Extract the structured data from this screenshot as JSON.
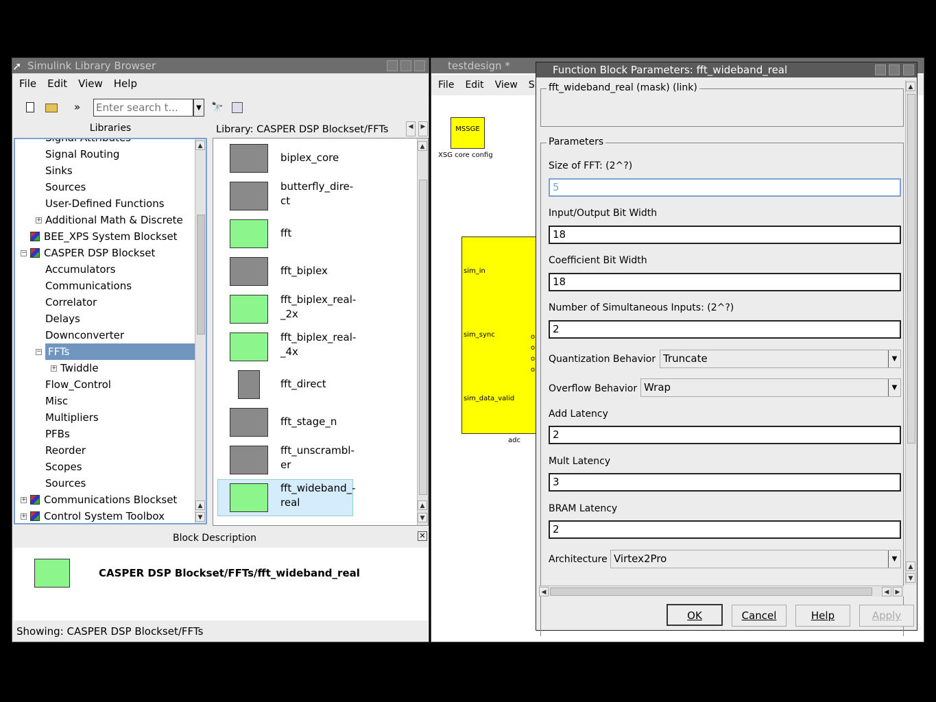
{
  "libbrowser": {
    "title": "Simulink Library Browser",
    "menu": [
      "File",
      "Edit",
      "View",
      "Help"
    ],
    "search_placeholder": "Enter search t...",
    "overflow": "»",
    "libraries_header": "Libraries",
    "library_path": "Library: CASPER DSP Blockset/FFTs",
    "tree": [
      {
        "label": "Signal Attributes",
        "indent": 1
      },
      {
        "label": "Signal Routing",
        "indent": 1
      },
      {
        "label": "Sinks",
        "indent": 1
      },
      {
        "label": "Sources",
        "indent": 1
      },
      {
        "label": "User-Defined Functions",
        "indent": 1
      },
      {
        "label": "Additional Math & Discrete",
        "indent": 1
      },
      {
        "label": "BEE_XPS System Blockset",
        "indent": 0
      },
      {
        "label": "CASPER DSP Blockset",
        "indent": 0
      },
      {
        "label": "Accumulators",
        "indent": 1
      },
      {
        "label": "Communications",
        "indent": 1
      },
      {
        "label": "Correlator",
        "indent": 1
      },
      {
        "label": "Delays",
        "indent": 1
      },
      {
        "label": "Downconverter",
        "indent": 1
      },
      {
        "label": "FFTs",
        "indent": 1
      },
      {
        "label": "Twiddle",
        "indent": 2
      },
      {
        "label": "Flow_Control",
        "indent": 1
      },
      {
        "label": "Misc",
        "indent": 1
      },
      {
        "label": "Multipliers",
        "indent": 1
      },
      {
        "label": "PFBs",
        "indent": 1
      },
      {
        "label": "Reorder",
        "indent": 1
      },
      {
        "label": "Scopes",
        "indent": 1
      },
      {
        "label": "Sources",
        "indent": 1
      },
      {
        "label": "Communications Blockset",
        "indent": 0
      },
      {
        "label": "Control System Toolbox",
        "indent": 0
      }
    ],
    "blocks": [
      {
        "label": "biplex_core",
        "color": "grey"
      },
      {
        "label": "butterfly_dire-\nct",
        "color": "grey"
      },
      {
        "label": "fft",
        "color": "green"
      },
      {
        "label": "fft_biplex",
        "color": "grey"
      },
      {
        "label": "fft_biplex_real-\n_2x",
        "color": "green"
      },
      {
        "label": "fft_biplex_real-\n_4x",
        "color": "green"
      },
      {
        "label": "fft_direct",
        "color": "grey"
      },
      {
        "label": "fft_stage_n",
        "color": "grey"
      },
      {
        "label": "fft_unscrambl-\ner",
        "color": "grey"
      },
      {
        "label": "fft_wideband_-\nreal",
        "color": "green"
      }
    ],
    "description_header": "Block Description",
    "description_text": "CASPER DSP Blockset/FFTs/fft_wideband_real",
    "status": "Showing: CASPER DSP Blockset/FFTs"
  },
  "model": {
    "title": "testdesign *",
    "menu": [
      "File",
      "Edit",
      "View",
      "Sim"
    ],
    "xsg_label": "MSSGE",
    "xsg_caption": "XSG core config",
    "adc_ports": [
      "sim_in",
      "sim_sync",
      "sim_data_valid"
    ],
    "adc_out_ports": [
      "o",
      "o",
      "o",
      "o"
    ],
    "adc_caption": "adc"
  },
  "dialog": {
    "title": "Function Block Parameters: fft_wideband_real",
    "mask_group": "fft_wideband_real (mask) (link)",
    "params_group": "Parameters",
    "fields": [
      {
        "label": "Size of FFT: (2^?)",
        "value": "5",
        "type": "text"
      },
      {
        "label": "Input/Output Bit Width",
        "value": "18",
        "type": "text"
      },
      {
        "label": "Coefficient Bit Width",
        "value": "18",
        "type": "text"
      },
      {
        "label": "Number of Simultaneous Inputs: (2^?)",
        "value": "2",
        "type": "text"
      }
    ],
    "quant_label": "Quantization Behavior",
    "quant_value": "Truncate",
    "overflow_label": "Overflow Behavior",
    "overflow_value": "Wrap",
    "add_latency_label": "Add Latency",
    "add_latency_value": "2",
    "mult_latency_label": "Mult Latency",
    "mult_latency_value": "3",
    "bram_latency_label": "BRAM Latency",
    "bram_latency_value": "2",
    "arch_label": "Architecture",
    "arch_value": "Virtex2Pro",
    "buttons": {
      "ok": "OK",
      "cancel": "Cancel",
      "help": "Help",
      "apply": "Apply"
    }
  }
}
